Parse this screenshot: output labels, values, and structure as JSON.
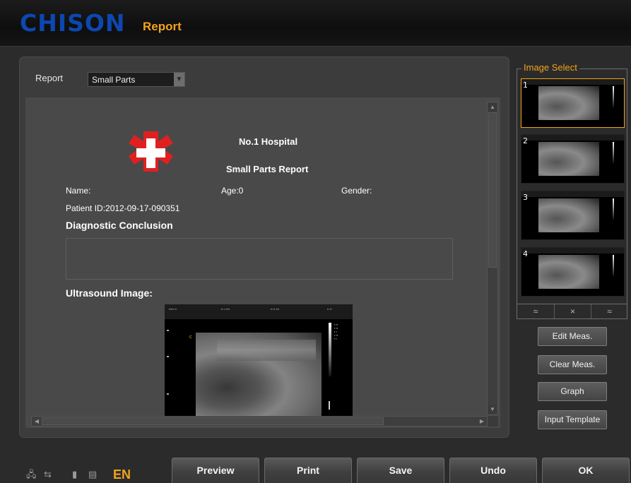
{
  "header": {
    "logo": "CHISON",
    "title": "Report"
  },
  "report": {
    "label": "Report",
    "selected": "Small Parts"
  },
  "document": {
    "hospital": "No.1 Hospital",
    "report_title": "Small Parts Report",
    "name_label": "Name:",
    "age_label": "Age:0",
    "gender_label": "Gender:",
    "patient_id": "Patient ID:2012-09-17-090351",
    "diagnostic_heading": "Diagnostic Conclusion",
    "ultrasound_heading": "Ultrasound Image:",
    "image_marker": "c"
  },
  "image_select": {
    "label": "Image Select",
    "thumbnails": [
      "1",
      "2",
      "3",
      "4"
    ],
    "selected": "1",
    "nav": {
      "up": "≈",
      "close": "×",
      "down": "≈"
    }
  },
  "side_buttons": {
    "edit": "Edit Meas.",
    "clear": "Clear Meas.",
    "graph": "Graph",
    "template": "Input Template"
  },
  "bottom": {
    "language": "EN",
    "buttons": {
      "preview": "Preview",
      "print": "Print",
      "save": "Save",
      "undo": "Undo",
      "ok": "OK"
    }
  },
  "colors": {
    "accent": "#f2a31c",
    "logo": "#0d47b0",
    "hospital_cross": "#e02020"
  }
}
